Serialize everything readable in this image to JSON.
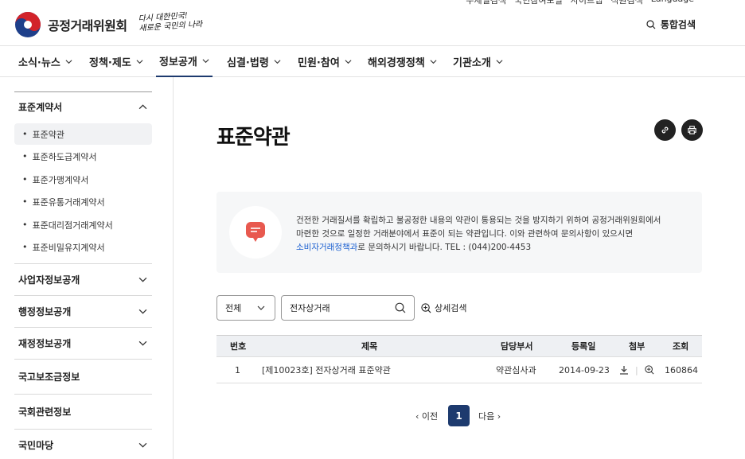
{
  "util": [
    "주제별검색",
    "국민참여포털",
    "사이트맵",
    "직원검색",
    "Language"
  ],
  "header": {
    "logo_text": "공정거래위원회",
    "slogan_line1": "다시 대한민국!",
    "slogan_line2": "새로운 국민의 나라",
    "search_label": "통합검색"
  },
  "gnb": [
    "소식·뉴스",
    "정책·제도",
    "정보공개",
    "심결·법령",
    "민원·참여",
    "해외경쟁정책",
    "기관소개"
  ],
  "sidebar": {
    "sections": [
      {
        "label": "표준계약서"
      },
      {
        "label": "사업자정보공개"
      },
      {
        "label": "행정정보공개"
      },
      {
        "label": "재정정보공개"
      },
      {
        "label": "국고보조금정보"
      },
      {
        "label": "국회관련정보"
      },
      {
        "label": "국민마당"
      }
    ],
    "subitems": [
      "표준약관",
      "표준하도급계약서",
      "표준가맹계약서",
      "표준유통거래계약서",
      "표준대리점거래계약서",
      "표준비밀유지계약서"
    ]
  },
  "main": {
    "title": "표준약관",
    "info_line1": "건전한 거래질서를 확립하고 불공정한 내용의 약관이 통용되는 것을 방지하기 위하여 공정거래위원회에서",
    "info_line2": "마련한 것으로 일정한 거래분야에서 표준이 되는 약관입니다. 이와 관련하여 문의사항이 있으시면",
    "info_link": "소비자거래정책과",
    "info_line3_rest": "로 문의하시기 바랍니다. TEL : (044)200-4453",
    "filter_value": "전체",
    "search_value": "전자상거래",
    "advanced_search": "상세검색"
  },
  "table": {
    "headers": [
      "번호",
      "제목",
      "담당부서",
      "등록일",
      "첨부",
      "조회"
    ],
    "rows": [
      {
        "no": "1",
        "title": "[제10023호] 전자상거래 표준약관",
        "dept": "약관심사과",
        "date": "2014-09-23",
        "views": "160864"
      }
    ]
  },
  "pager": {
    "prev": "이전",
    "current": "1",
    "next": "다음"
  },
  "colors": {
    "accent": "#1d3a6e",
    "link": "#1a5fd0",
    "icon_red": "#e8594f"
  }
}
